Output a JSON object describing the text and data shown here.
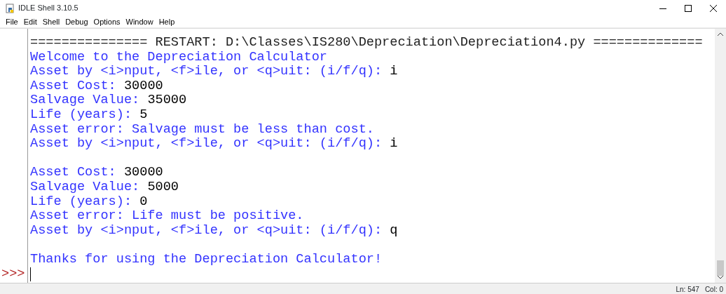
{
  "window": {
    "title": "IDLE Shell 3.10.5"
  },
  "menu": [
    "File",
    "Edit",
    "Shell",
    "Debug",
    "Options",
    "Window",
    "Help"
  ],
  "shell": {
    "lines": [
      {
        "kind": "text",
        "segments": [
          {
            "kind": "restart",
            "text": "=============== RESTART: D:\\Classes\\IS280\\Depreciation\\Depreciation4.py =============="
          }
        ]
      },
      {
        "kind": "text",
        "segments": [
          {
            "kind": "output",
            "text": "Welcome to the Depreciation Calculator"
          }
        ]
      },
      {
        "kind": "text",
        "segments": [
          {
            "kind": "output",
            "text": "Asset by <i>nput, <f>ile, or <q>uit: (i/f/q): "
          },
          {
            "kind": "input",
            "text": "i"
          }
        ]
      },
      {
        "kind": "text",
        "segments": [
          {
            "kind": "output",
            "text": "Asset Cost: "
          },
          {
            "kind": "input",
            "text": "30000"
          }
        ]
      },
      {
        "kind": "text",
        "segments": [
          {
            "kind": "output",
            "text": "Salvage Value: "
          },
          {
            "kind": "input",
            "text": "35000"
          }
        ]
      },
      {
        "kind": "text",
        "segments": [
          {
            "kind": "output",
            "text": "Life (years): "
          },
          {
            "kind": "input",
            "text": "5"
          }
        ]
      },
      {
        "kind": "text",
        "segments": [
          {
            "kind": "output",
            "text": "Asset error: Salvage must be less than cost."
          }
        ]
      },
      {
        "kind": "text",
        "segments": [
          {
            "kind": "output",
            "text": "Asset by <i>nput, <f>ile, or <q>uit: (i/f/q): "
          },
          {
            "kind": "input",
            "text": "i"
          }
        ]
      },
      {
        "kind": "blank"
      },
      {
        "kind": "text",
        "segments": [
          {
            "kind": "output",
            "text": "Asset Cost: "
          },
          {
            "kind": "input",
            "text": "30000"
          }
        ]
      },
      {
        "kind": "text",
        "segments": [
          {
            "kind": "output",
            "text": "Salvage Value: "
          },
          {
            "kind": "input",
            "text": "5000"
          }
        ]
      },
      {
        "kind": "text",
        "segments": [
          {
            "kind": "output",
            "text": "Life (years): "
          },
          {
            "kind": "input",
            "text": "0"
          }
        ]
      },
      {
        "kind": "text",
        "segments": [
          {
            "kind": "output",
            "text": "Asset error: Life must be positive."
          }
        ]
      },
      {
        "kind": "text",
        "segments": [
          {
            "kind": "output",
            "text": "Asset by <i>nput, <f>ile, or <q>uit: (i/f/q): "
          },
          {
            "kind": "input",
            "text": "q"
          }
        ]
      },
      {
        "kind": "blank"
      },
      {
        "kind": "text",
        "segments": [
          {
            "kind": "output",
            "text": "Thanks for using the Depreciation Calculator!"
          }
        ]
      }
    ],
    "prompt": ">>>"
  },
  "status_bar": {
    "line": "Ln: 547",
    "column": "Col: 0"
  }
}
